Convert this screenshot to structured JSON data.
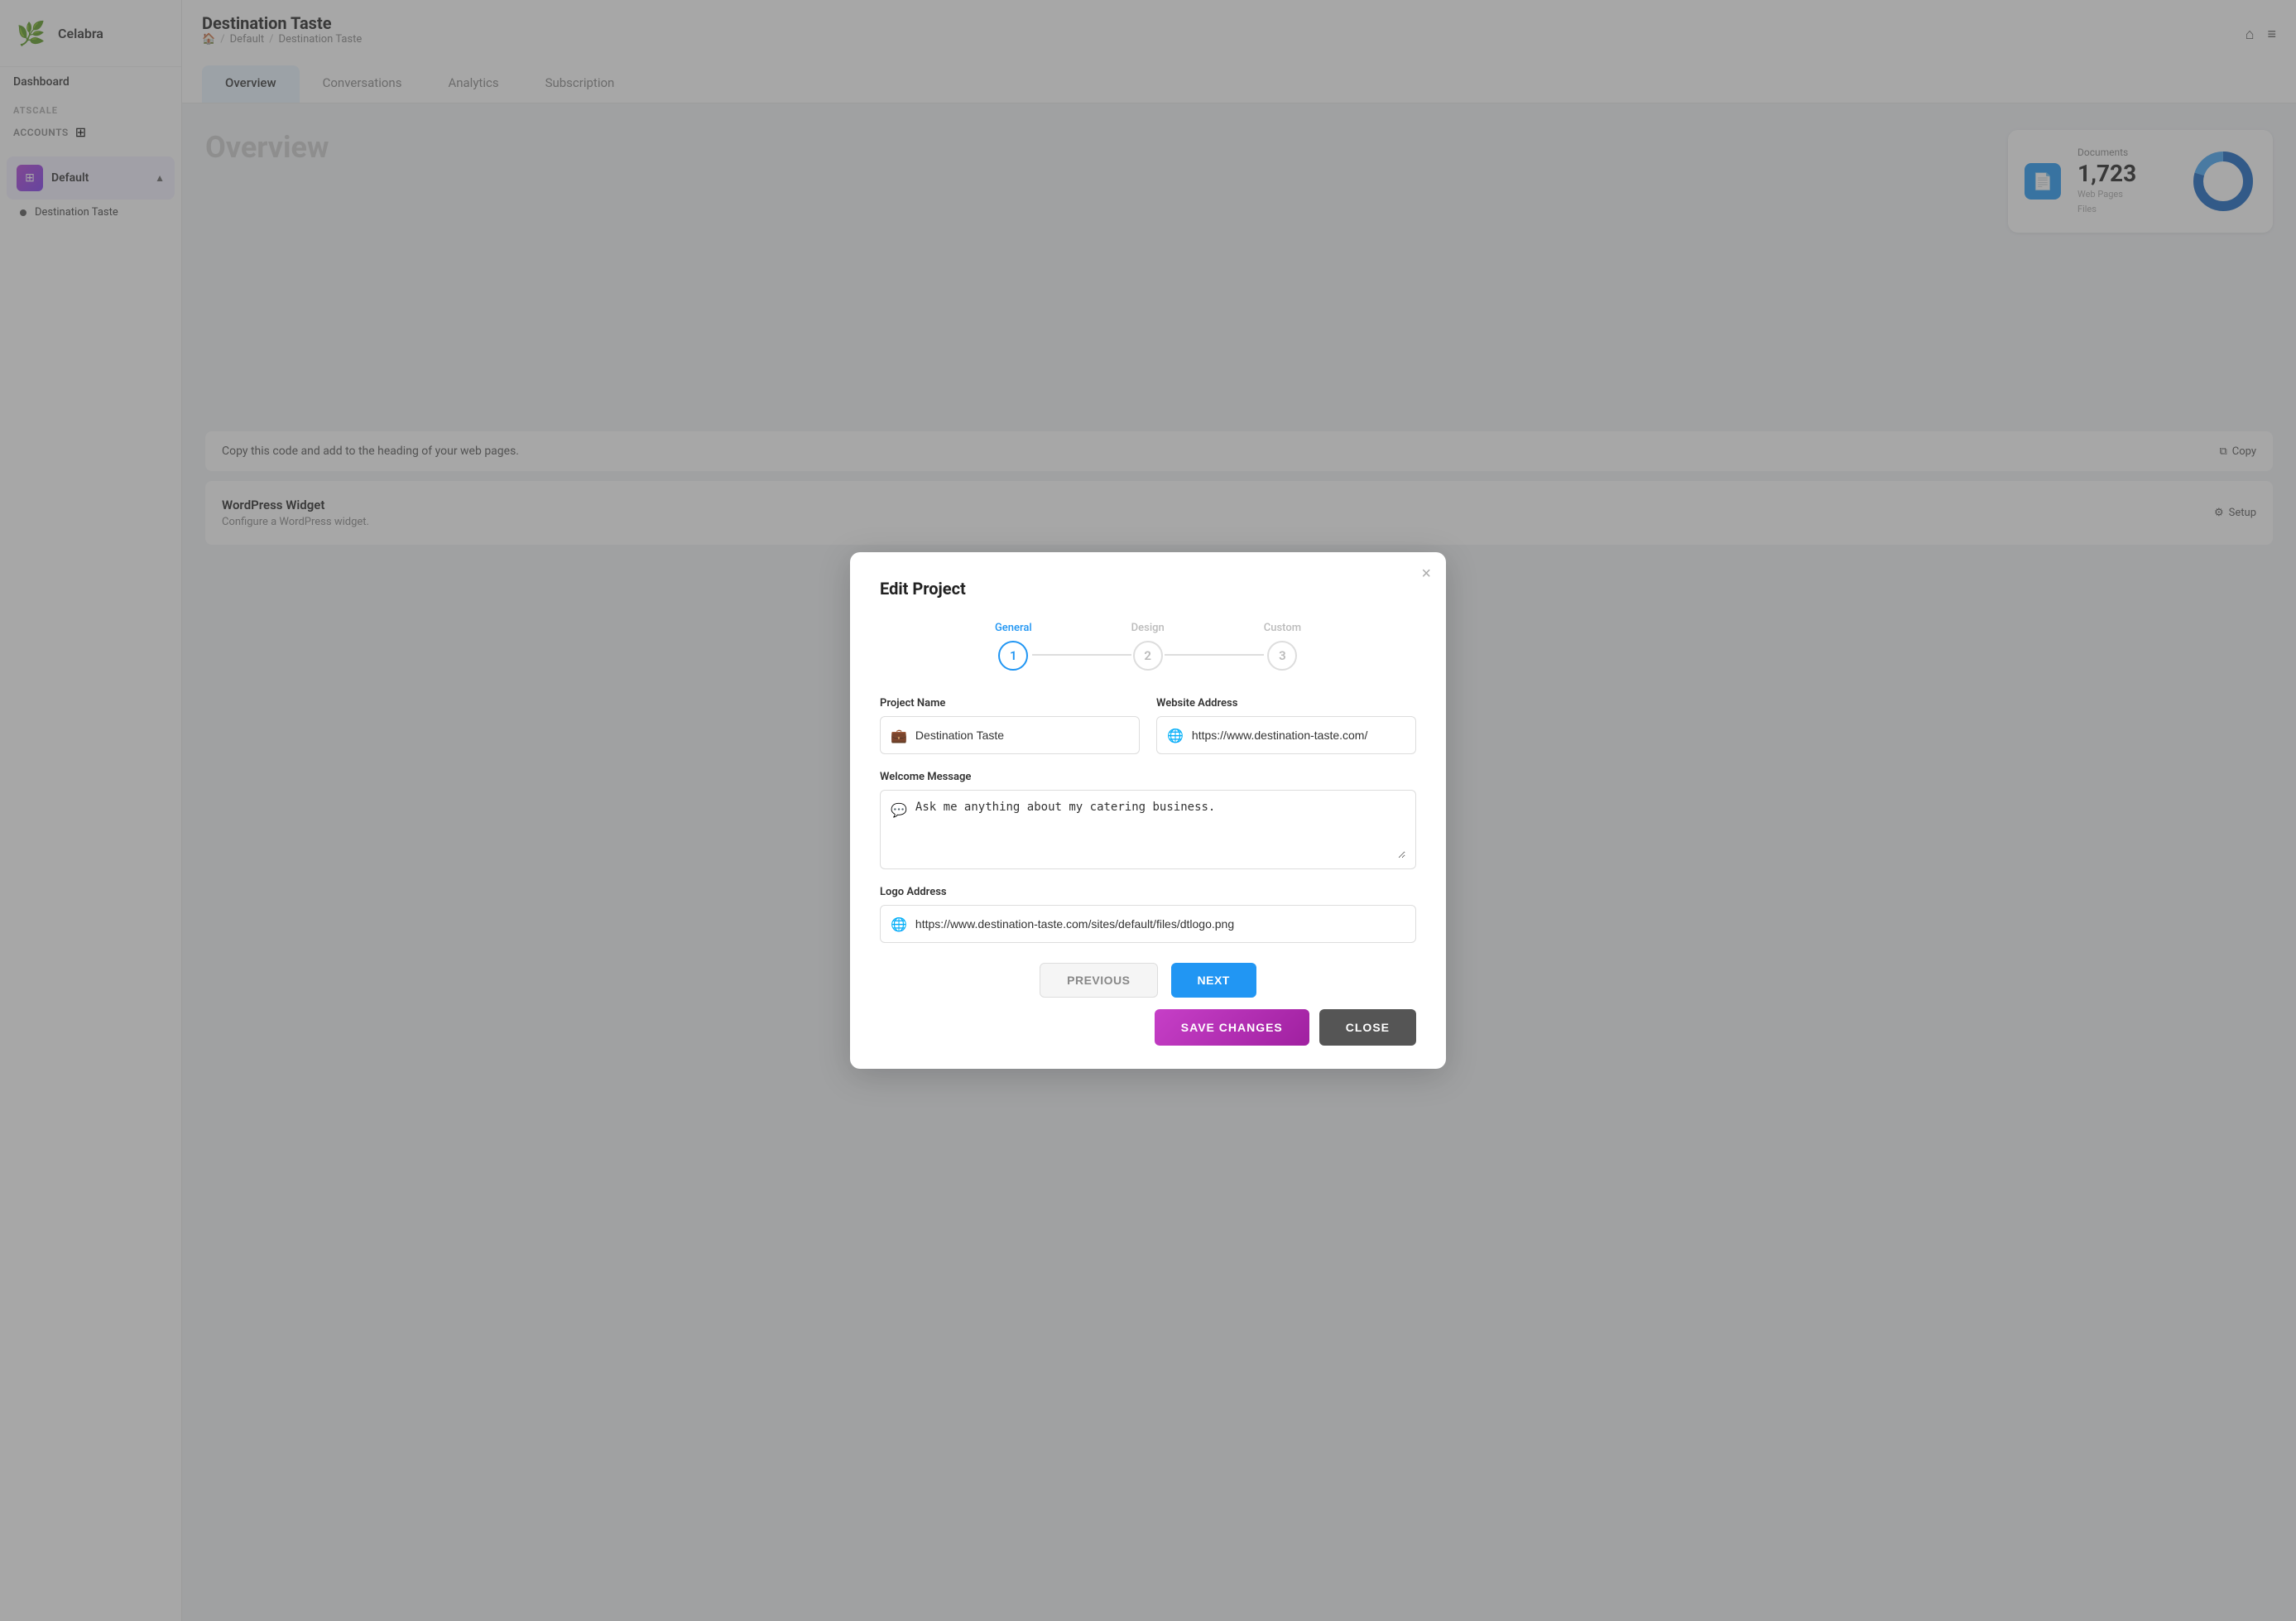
{
  "sidebar": {
    "logo_text": "Celabra",
    "dashboard_label": "Dashboard",
    "atscale_label": "ATSCALE",
    "accounts_label": "ACCOUNTS",
    "group": {
      "name": "Default",
      "icon": "⊞"
    },
    "items": [
      {
        "label": "Destination Taste"
      }
    ]
  },
  "header": {
    "title": "Destination Taste",
    "breadcrumb": {
      "home": "🏠",
      "separator1": "/",
      "default": "Default",
      "separator2": "/",
      "current": "Destination Taste"
    },
    "tabs": [
      {
        "label": "Overview",
        "active": true
      },
      {
        "label": "Conversations",
        "active": false
      },
      {
        "label": "Analytics",
        "active": false
      },
      {
        "label": "Subscription",
        "active": false
      }
    ]
  },
  "page": {
    "overview_title": "Overview",
    "documents_card": {
      "label": "Documents",
      "count": "1,723",
      "sub_lines": [
        "Web Pages",
        "Files"
      ]
    },
    "bottom": {
      "copy_code_text": "Copy this code and add to the heading of your web pages.",
      "copy_label": "Copy",
      "wordpress_title": "WordPress Widget",
      "wordpress_sub": "Configure a WordPress widget.",
      "setup_label": "Setup"
    }
  },
  "modal": {
    "title": "Edit Project",
    "close_btn": "×",
    "steps": [
      {
        "label": "General",
        "number": "1",
        "active": true
      },
      {
        "label": "Design",
        "number": "2",
        "active": false
      },
      {
        "label": "Custom",
        "number": "3",
        "active": false
      }
    ],
    "form": {
      "project_name_label": "Project Name",
      "project_name_value": "Destination Taste",
      "project_name_placeholder": "Destination Taste",
      "website_address_label": "Website Address",
      "website_address_value": "https://www.destination-taste.com/",
      "website_address_placeholder": "https://www.destination-taste.com/",
      "welcome_message_label": "Welcome Message",
      "welcome_message_value": "Ask me anything about my catering business.",
      "logo_address_label": "Logo Address",
      "logo_address_value": "https://www.destination-taste.com/sites/default/files/dtlogo.png"
    },
    "buttons": {
      "previous": "PREVIOUS",
      "next": "NEXT",
      "save_changes": "SAVE CHANGES",
      "close": "CLOSE"
    }
  },
  "colors": {
    "accent_blue": "#2196F3",
    "accent_purple": "#9c27b0",
    "save_btn": "#c63fc7",
    "close_btn": "#555555"
  }
}
